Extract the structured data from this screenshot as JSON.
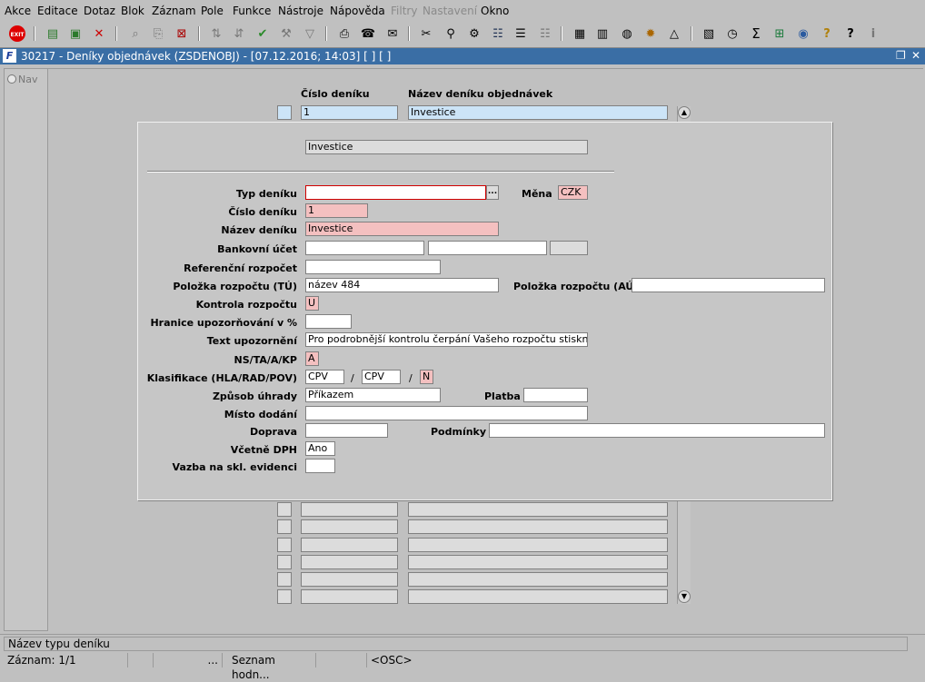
{
  "menu": [
    "Akce",
    "Editace",
    "Dotaz",
    "Blok",
    "Záznam",
    "Pole",
    "Funkce",
    "Nástroje",
    "Nápověda",
    "Filtry",
    "Nastavení",
    "Okno"
  ],
  "menu_disabled": [
    "Filtry",
    "Nastavení"
  ],
  "toolbar_icons": [
    "exit-icon",
    "insert-record-icon",
    "save-record-icon",
    "delete-record-icon",
    "query-icon",
    "execute-query-icon",
    "cancel-query-icon",
    "sort-asc-icon",
    "sort-desc-icon",
    "check-icon",
    "wrench-icon",
    "filter-icon",
    "print-icon",
    "fax-icon",
    "mail-icon",
    "cut-icon",
    "attach-icon",
    "tool-icon",
    "list-icon",
    "tree-icon",
    "report-icon",
    "document-icon",
    "globe-icon",
    "sun-icon",
    "scale-icon",
    "chart-icon",
    "clock-icon",
    "sum-icon",
    "excel-icon",
    "web-icon",
    "help-icon",
    "info-icon",
    "about-icon"
  ],
  "window": {
    "title": "30217 - Deníky objednávek (ZSDENOBJ) - [07.12.2016; 14:03]  [ ] [ ]"
  },
  "nav": {
    "label": "Nav"
  },
  "grid": {
    "col_number": "Číslo deníku",
    "col_name": "Název deníku objednávek",
    "first_row": {
      "number": "1",
      "name": "Investice"
    }
  },
  "detail": {
    "header_value": "Investice",
    "fields": {
      "typ_deniku": {
        "label": "Typ deníku",
        "value": ""
      },
      "mena": {
        "label": "Měna",
        "value": "CZK"
      },
      "cislo_deniku": {
        "label": "Číslo deníku",
        "value": "1"
      },
      "nazev_deniku": {
        "label": "Název deníku",
        "value": "Investice"
      },
      "bankovni_ucet": {
        "label": "Bankovní účet",
        "value1": "",
        "value2": "",
        "value3": ""
      },
      "referencni_rozpocet": {
        "label": "Referenční rozpočet",
        "value": ""
      },
      "polozka_tu": {
        "label": "Položka rozpočtu (TÚ)",
        "value": "název 484"
      },
      "polozka_au": {
        "label": "Položka rozpočtu (AÚ)",
        "value": ""
      },
      "kontrola_rozpoctu": {
        "label": "Kontrola rozpočtu",
        "value": "U"
      },
      "hranice": {
        "label": "Hranice upozorňování v %",
        "value": ""
      },
      "text_upozorneni": {
        "label": "Text upozornění",
        "value": "Pro podrobnější kontrolu čerpání Vašeho rozpočtu stiskněte tlač"
      },
      "ns_ta": {
        "label": "NS/TA/A/KP",
        "value": "A"
      },
      "klasifikace": {
        "label": "Klasifikace (HLA/RAD/POV)",
        "value1": "CPV",
        "sep": "/",
        "value2": "CPV",
        "value3": "N"
      },
      "zpusob_uhrady": {
        "label": "Způsob úhrady",
        "value": "Příkazem"
      },
      "platba": {
        "label": "Platba",
        "value": ""
      },
      "misto_dodani": {
        "label": "Místo dodání",
        "value": ""
      },
      "doprava": {
        "label": "Doprava",
        "value": ""
      },
      "podminky": {
        "label": "Podmínky",
        "value": ""
      },
      "vcetne_dph": {
        "label": "Včetně DPH",
        "value": "Ano"
      },
      "vazba": {
        "label": "Vazba na skl. evidenci",
        "value": ""
      }
    },
    "lov_button": "..."
  },
  "status": {
    "hint": "Název typu deníku",
    "record": "Záznam: 1/1",
    "seg2": "",
    "seg3": "...",
    "list": "Seznam hodn...",
    "seg5": "",
    "osc": "<OSC>"
  }
}
